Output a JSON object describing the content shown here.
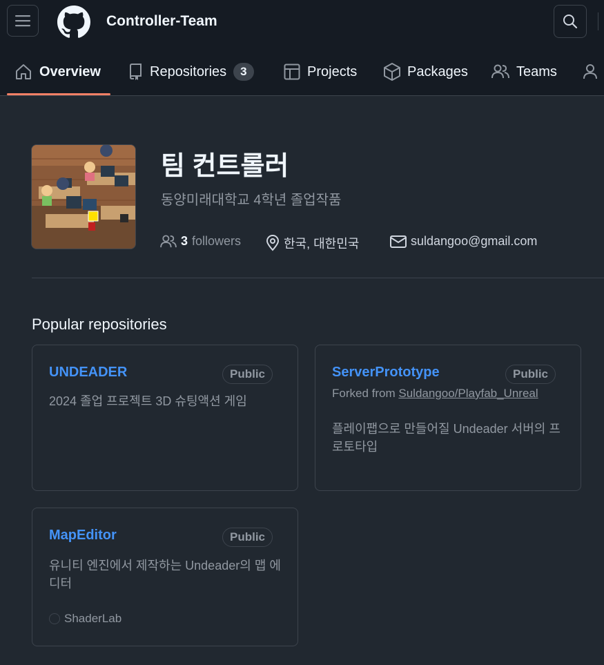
{
  "header": {
    "org_name": "Controller-Team",
    "menu_icon": "hamburger-icon",
    "logo_icon": "github-logo-icon",
    "search_icon": "search-icon"
  },
  "tabs": [
    {
      "label": "Overview",
      "icon": "home-icon",
      "active": true
    },
    {
      "label": "Repositories",
      "icon": "repo-icon",
      "count": "3"
    },
    {
      "label": "Projects",
      "icon": "table-icon"
    },
    {
      "label": "Packages",
      "icon": "package-icon"
    },
    {
      "label": "Teams",
      "icon": "people-icon"
    },
    {
      "label": "",
      "icon": "person-icon"
    }
  ],
  "profile": {
    "title": "팀 컨트롤러",
    "description": "동양미래대학교 4학년 졸업작품",
    "followers_count": "3",
    "followers_label": "followers",
    "location": "한국, 대한민국",
    "email": "suldangoo@gmail.com"
  },
  "popular": {
    "title": "Popular repositories",
    "repos": [
      {
        "name": "UNDEADER",
        "visibility": "Public",
        "description": "2024 졸업 프로젝트 3D 슈팅액션 게임"
      },
      {
        "name": "ServerPrototype",
        "visibility": "Public",
        "forked_prefix": "Forked from",
        "forked_from": "Suldangoo/Playfab_Unreal",
        "description": "플레이팹으로 만들어질 Undeader 서버의 프로토타입"
      },
      {
        "name": "MapEditor",
        "visibility": "Public",
        "description": "유니티 엔진에서 제작하는 Undeader의 맵 에디터",
        "language": "ShaderLab"
      }
    ]
  },
  "colors": {
    "accent_link": "#4493f8",
    "tab_underline": "#f78166",
    "background": "#212830",
    "header_bg": "#151b23"
  }
}
